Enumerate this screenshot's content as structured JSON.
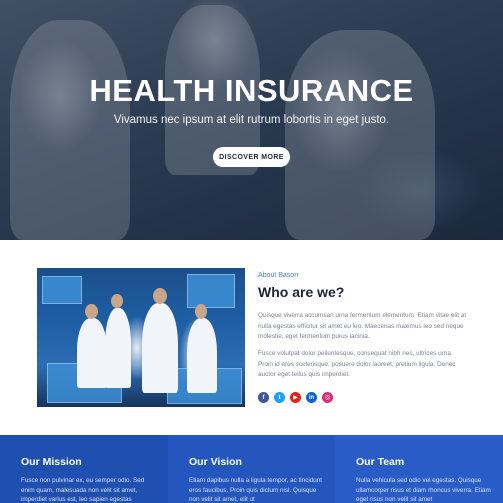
{
  "hero": {
    "title": "HEALTH INSURANCE",
    "subtitle": "Vivamus nec ipsum at elit rutrum lobortis in eget justo.",
    "button_label": "DISCOVER MORE"
  },
  "about": {
    "kicker": "About Bason",
    "title": "Who are we?",
    "paragraph_1": "Quisque viverra accumsan urna fermentum elementum. Etiam vitae elit at nulla egestas efficitur sit amet eu leo. Maecenas maximus leo sed neque molestie, eget fermentum purus lacinia.",
    "paragraph_2": "Fusce volutpat dolor pellentesque, consequat nibh nec, ultrices urna. Proin id eros scelerisque, posuere dolor laoreet, pretium ligula. Donec auctor eget tellus quis imperdiet.",
    "socials": [
      {
        "name": "facebook-icon",
        "glyph": "f",
        "color": "#3b5998"
      },
      {
        "name": "twitter-icon",
        "glyph": "t",
        "color": "#1da1f2"
      },
      {
        "name": "youtube-icon",
        "glyph": "▶",
        "color": "#e62117"
      },
      {
        "name": "linkedin-icon",
        "glyph": "in",
        "color": "#0a66c2"
      },
      {
        "name": "instagram-icon",
        "glyph": "◎",
        "color": "#d6307a"
      }
    ]
  },
  "features": [
    {
      "title": "Our Mission",
      "text": "Fusce non pulvinar ex, eu semper odio. Sed enim quam, malesuada non velit sit amet, imperdiet varius est, leo sapien egestas"
    },
    {
      "title": "Our Vision",
      "text": "Etiam dapibus nulla a ligula tempor, ac tincidunt eros faucibus. Proin quis dictum nisl. Quisque non velit sit amet, elit ut"
    },
    {
      "title": "Our Team",
      "text": "Nulla vehicula sed odio vel egestas. Quisque ullamcorper risus et diam rhoncus viverra. Etiam eget risus non velit sit amet"
    }
  ]
}
